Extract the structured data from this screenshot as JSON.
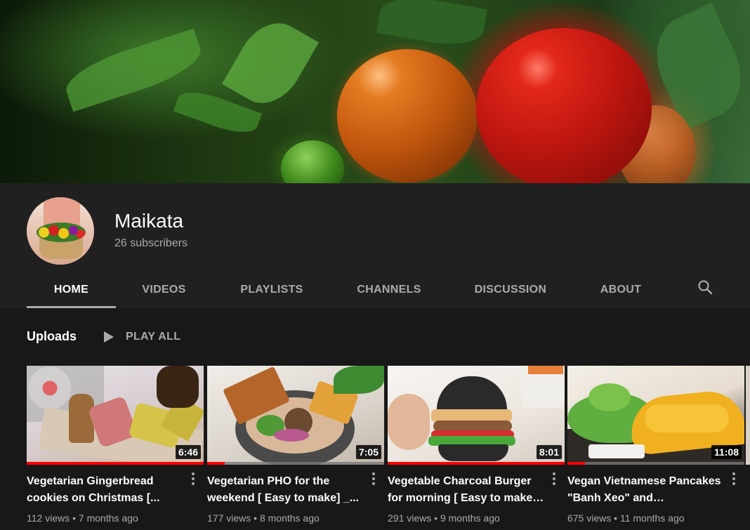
{
  "channel": {
    "name": "Maikata",
    "subscribers": "26 subscribers"
  },
  "tabs": [
    {
      "label": "HOME",
      "active": true
    },
    {
      "label": "VIDEOS",
      "active": false
    },
    {
      "label": "PLAYLISTS",
      "active": false
    },
    {
      "label": "CHANNELS",
      "active": false
    },
    {
      "label": "DISCUSSION",
      "active": false
    },
    {
      "label": "ABOUT",
      "active": false
    }
  ],
  "icons": {
    "search": "search-icon",
    "play_all": "play-icon",
    "more": "more-vertical-icon"
  },
  "uploads": {
    "title": "Uploads",
    "play_all_label": "PLAY ALL",
    "videos": [
      {
        "title": "Vegetarian Gingerbread cookies on Christmas [...",
        "duration": "6:46",
        "views": "112 views",
        "age": "7 months ago",
        "watched_fraction": 1.0
      },
      {
        "title": "Vegetarian PHO for the weekend [ Easy to make] _...",
        "duration": "7:05",
        "views": "177 views",
        "age": "8 months ago",
        "watched_fraction": 0.1
      },
      {
        "title": "Vegetable Charcoal Burger for morning [ Easy to make…",
        "duration": "8:01",
        "views": "291 views",
        "age": "9 months ago",
        "watched_fraction": 1.0
      },
      {
        "title": "Vegan Vietnamese Pancakes \"Banh Xeo\" and…",
        "duration": "11:08",
        "views": "675 views",
        "age": "11 months ago",
        "watched_fraction": 0.1
      }
    ]
  },
  "colors": {
    "page_bg": "#181818",
    "header_bg": "#202020",
    "text_primary": "#ffffff",
    "text_secondary": "#aaaaaa",
    "progress_red": "#ff0000"
  }
}
